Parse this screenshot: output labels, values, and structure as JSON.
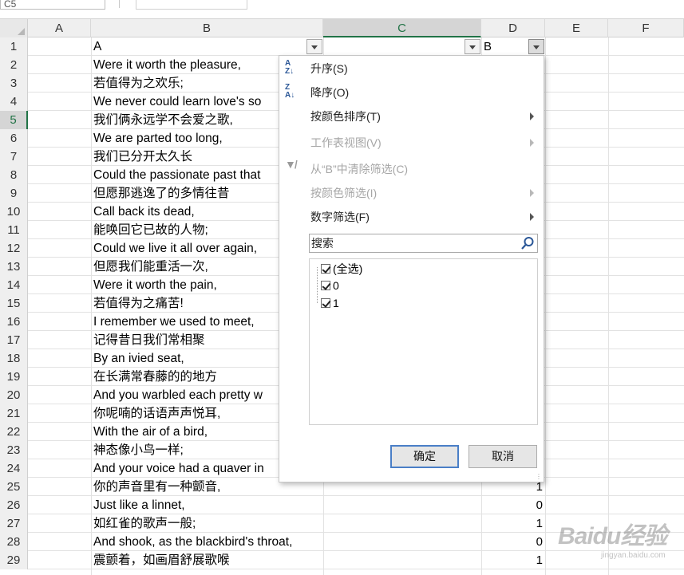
{
  "name_box": "C5",
  "columns": [
    "A",
    "B",
    "C",
    "D",
    "E",
    "F"
  ],
  "rows": [
    {
      "n": "1",
      "b": "A",
      "d": "B"
    },
    {
      "n": "2",
      "b": "Were it worth the pleasure,",
      "d": ""
    },
    {
      "n": "3",
      "b": "若值得为之欢乐;",
      "d": ""
    },
    {
      "n": "4",
      "b": "We never could learn love's so",
      "d": ""
    },
    {
      "n": "5",
      "b": "我们俩永远学不会爱之歌,",
      "d": ""
    },
    {
      "n": "6",
      "b": "We are parted too long,",
      "d": ""
    },
    {
      "n": "7",
      "b": "我们已分开太久长",
      "d": ""
    },
    {
      "n": "8",
      "b": "Could the passionate past that",
      "d": ""
    },
    {
      "n": "9",
      "b": "但愿那逃逸了的多情往昔",
      "d": ""
    },
    {
      "n": "10",
      "b": "Call back its dead,",
      "d": ""
    },
    {
      "n": "11",
      "b": "能唤回它已故的人物;",
      "d": ""
    },
    {
      "n": "12",
      "b": "Could we live it all over again,",
      "d": ""
    },
    {
      "n": "13",
      "b": "但愿我们能重活一次,",
      "d": ""
    },
    {
      "n": "14",
      "b": "Were it worth the pain,",
      "d": ""
    },
    {
      "n": "15",
      "b": "若值得为之痛苦!",
      "d": ""
    },
    {
      "n": "16",
      "b": "I remember we used to meet,",
      "d": ""
    },
    {
      "n": "17",
      "b": "记得昔日我们常相聚",
      "d": ""
    },
    {
      "n": "18",
      "b": "By an ivied seat,",
      "d": ""
    },
    {
      "n": "19",
      "b": "在长满常春藤的的地方",
      "d": ""
    },
    {
      "n": "20",
      "b": "And you warbled each pretty w",
      "d": ""
    },
    {
      "n": "21",
      "b": "你呢喃的话语声声悦耳,",
      "d": ""
    },
    {
      "n": "22",
      "b": "With the air of a bird,",
      "d": ""
    },
    {
      "n": "23",
      "b": "神态像小鸟一样;",
      "d": ""
    },
    {
      "n": "24",
      "b": "And your voice had a quaver in",
      "d": ""
    },
    {
      "n": "25",
      "b": "你的声音里有一种颤音,",
      "d": "1"
    },
    {
      "n": "26",
      "b": "Just like a linnet,",
      "d": "0"
    },
    {
      "n": "27",
      "b": "如红雀的歌声一般;",
      "d": "1"
    },
    {
      "n": "28",
      "b": "And shook, as the blackbird's throat,",
      "d": "0"
    },
    {
      "n": "29",
      "b": "震颤着，如画眉舒展歌喉",
      "d": "1"
    }
  ],
  "filter_menu": {
    "sort_asc": "升序(S)",
    "sort_desc": "降序(O)",
    "sort_by_color": "按颜色排序(T)",
    "sheet_view": "工作表视图(V)",
    "clear_filter": "从“B”中清除筛选(C)",
    "filter_by_color": "按颜色筛选(I)",
    "number_filter": "数字筛选(F)",
    "search_placeholder": "搜索",
    "values": [
      "(全选)",
      "0",
      "1"
    ],
    "ok": "确定",
    "cancel": "取消"
  },
  "watermark": {
    "logo": "Baidu经验",
    "sub": "jingyan.baidu.com"
  },
  "colors": {
    "accent": "#217346",
    "button_focus": "#4a7fc7",
    "disabled": "#a6a6a6"
  }
}
